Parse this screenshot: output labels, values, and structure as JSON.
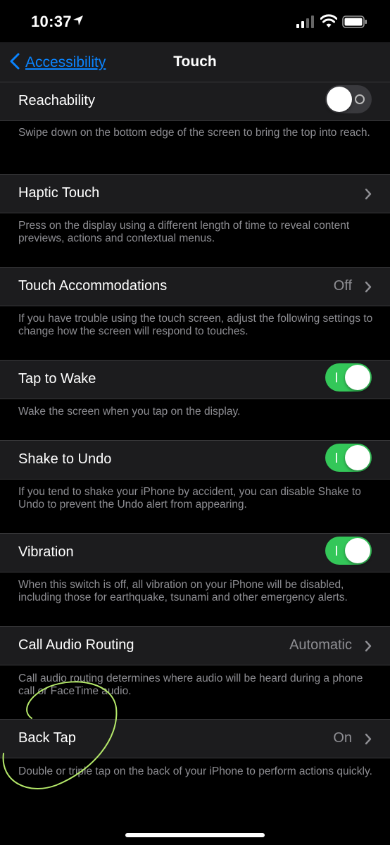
{
  "status_bar": {
    "time": "10:37"
  },
  "nav": {
    "back_label": "Accessibility",
    "title": "Touch"
  },
  "rows": {
    "reachability": {
      "label": "Reachability",
      "toggle": "off",
      "footer": "Swipe down on the bottom edge of the screen to bring the top into reach."
    },
    "haptic_touch": {
      "label": "Haptic Touch",
      "footer": "Press on the display using a different length of time to reveal content previews, actions and contextual menus."
    },
    "touch_accommodations": {
      "label": "Touch Accommodations",
      "value": "Off",
      "footer": "If you have trouble using the touch screen, adjust the following settings to change how the screen will respond to touches."
    },
    "tap_to_wake": {
      "label": "Tap to Wake",
      "toggle": "on",
      "footer": "Wake the screen when you tap on the display."
    },
    "shake_to_undo": {
      "label": "Shake to Undo",
      "toggle": "on",
      "footer": "If you tend to shake your iPhone by accident, you can disable Shake to Undo to prevent the Undo alert from appearing."
    },
    "vibration": {
      "label": "Vibration",
      "toggle": "on",
      "footer": "When this switch is off, all vibration on your iPhone will be disabled, including those for earthquake, tsunami and other emergency alerts."
    },
    "call_audio_routing": {
      "label": "Call Audio Routing",
      "value": "Automatic",
      "footer": "Call audio routing determines where audio will be heard during a phone call or FaceTime audio."
    },
    "back_tap": {
      "label": "Back Tap",
      "value": "On",
      "footer": "Double or triple tap on the back of your iPhone to perform actions quickly."
    }
  },
  "colors": {
    "accent": "#0a84ff",
    "toggle_on": "#34c759",
    "annotation": "#b5e96a"
  },
  "icons": [
    "location-arrow-icon",
    "cellular-signal-icon",
    "wifi-icon",
    "battery-icon",
    "chevron-left-icon",
    "chevron-right-icon"
  ]
}
